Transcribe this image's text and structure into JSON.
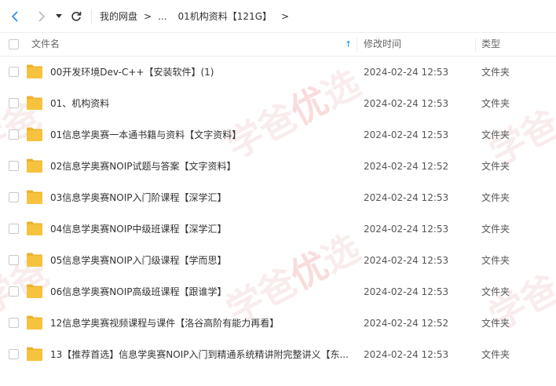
{
  "toolbar": {
    "back_icon": "chevron-left-icon",
    "forward_icon": "chevron-right-icon",
    "dropdown_icon": "triangle-down-icon",
    "refresh_icon": "refresh-icon",
    "breadcrumb": {
      "root": "我的网盘",
      "sep1": ">",
      "ellipsis": "...",
      "current": "01机构资料【121G】",
      "sep2": ">"
    }
  },
  "table": {
    "columns": {
      "name": "文件名",
      "sort_icon": "↑",
      "modified": "修改时间",
      "type": "类型"
    },
    "rows": [
      {
        "name": "00开发环境Dev-C++【安装软件】(1)",
        "modified": "2024-02-24 12:53",
        "type": "文件夹"
      },
      {
        "name": "01、机构资料",
        "modified": "2024-02-24 12:53",
        "type": "文件夹"
      },
      {
        "name": "01信息学奥赛一本通书籍与资料【文字资料】",
        "modified": "2024-02-24 12:53",
        "type": "文件夹"
      },
      {
        "name": "02信息学奥赛NOIP试题与答案【文字资料】",
        "modified": "2024-02-24 12:52",
        "type": "文件夹"
      },
      {
        "name": "03信息学奥赛NOIP入门阶课程【深学汇】",
        "modified": "2024-02-24 12:53",
        "type": "文件夹"
      },
      {
        "name": "04信息学奥赛NOIP中级班课程【深学汇】",
        "modified": "2024-02-24 12:53",
        "type": "文件夹"
      },
      {
        "name": "05信息学奥赛NOIP入门级课程【学而思】",
        "modified": "2024-02-24 12:53",
        "type": "文件夹"
      },
      {
        "name": "06信息学奥赛NOIP高级班课程【跟谁学】",
        "modified": "2024-02-24 12:53",
        "type": "文件夹"
      },
      {
        "name": "12信息学奥赛视频课程与课件【洛谷高阶有能力再看】",
        "modified": "2024-02-24 12:52",
        "type": "文件夹"
      },
      {
        "name": "13【推荐首选】信息学奥赛NOIP入门到精通系统精讲附完整讲义【东...",
        "modified": "2024-02-24 12:53",
        "type": "文件夹"
      }
    ]
  },
  "watermark": {
    "text_a": "学爸",
    "text_b": "优",
    "text_c": "选"
  },
  "colors": {
    "folder": "#f7c23e",
    "folder_dark": "#eeb22b",
    "accent": "#1a8cf0"
  }
}
